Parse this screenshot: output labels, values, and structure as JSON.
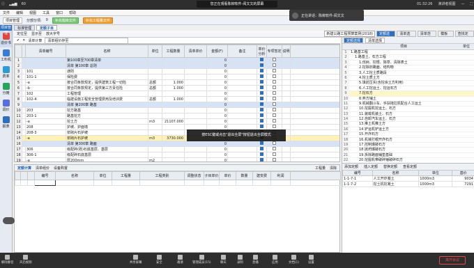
{
  "meeting_top": {
    "signal": "60",
    "share_text": "您正在观看陈柳软件-阅文文的屏幕",
    "clock": "01:32:26",
    "view_label": "演讲者视图",
    "colors": {
      "bg": "#2e2e2e"
    }
  },
  "toast": {
    "text": "正在讲话：陈柳软件-阅文文"
  },
  "app": {
    "menu": [
      "文件",
      "编辑",
      "视图",
      "工具",
      "窗口",
      "帮助"
    ],
    "toolbar": {
      "info": "项目管理",
      "count_label": "分部分项:",
      "count_value": "0",
      "green_btn": "补充题库文件",
      "orange_btn": "补充工程量文件"
    },
    "tabs": [
      "标准管理",
      "定额子目"
    ],
    "subtool": [
      "定位至",
      "显示至",
      "放大字号"
    ],
    "standard_label": "新建公路工程预算案例(2018)",
    "right_tabs": [
      "定额选择",
      "清单选择",
      "清单范本",
      "模板库",
      "查找定位"
    ],
    "filter_bar": {
      "a": "清单计算",
      "b": "清单库",
      "c": "清单组价存至"
    },
    "grid_headers": [
      "清单编号",
      "名称",
      "单位",
      "工程数量",
      "清单单价",
      "金额(F)",
      "备注",
      "单价分析",
      "专项暂定",
      "说明"
    ],
    "rows": [
      {
        "no": "1",
        "code": "",
        "name": "第100章至700章清单",
        "unit": "",
        "qty": "",
        "price": "",
        "amt": "0",
        "hl": true
      },
      {
        "no": "2",
        "code": "",
        "name": "清单 第100章 总则",
        "unit": "",
        "qty": "",
        "price": "",
        "amt": "0",
        "hl": true
      },
      {
        "no": "3",
        "code": "101",
        "name": "通则",
        "unit": "",
        "qty": "",
        "price": "",
        "amt": "0"
      },
      {
        "no": "4",
        "code": "101-1",
        "name": "保险费",
        "unit": "",
        "qty": "",
        "price": "",
        "amt": "0"
      },
      {
        "no": "5",
        "code": "-a",
        "name": "按合同条款规定，提供建筑工程一切险",
        "unit": "总额",
        "qty": "1.000",
        "price": "",
        "amt": "0"
      },
      {
        "no": "6",
        "code": "-b",
        "name": "按合同条款规定，提供第三方责任险",
        "unit": "总额",
        "qty": "1.000",
        "price": "",
        "amt": "0"
      },
      {
        "no": "7",
        "code": "102",
        "name": "工程管理",
        "unit": "",
        "qty": "",
        "price": "",
        "amt": "0"
      },
      {
        "no": "8",
        "code": "102-4",
        "name": "临建设施工程安全管理费用及培训费",
        "unit": "总额",
        "qty": "1.000",
        "price": "",
        "amt": "0"
      },
      {
        "no": "9",
        "code": "",
        "name": "清单 第200章 路基",
        "unit": "",
        "qty": "",
        "price": "",
        "amt": "0",
        "hl": true
      },
      {
        "no": "10",
        "code": "203",
        "name": "挖方路基",
        "unit": "",
        "qty": "",
        "price": "",
        "amt": "0"
      },
      {
        "no": "11",
        "code": "203-1",
        "name": "路基挖方",
        "unit": "",
        "qty": "",
        "price": "",
        "amt": "0"
      },
      {
        "no": "12",
        "code": "-a",
        "name": "挖土方",
        "unit": "m3",
        "qty": "21107.000",
        "price": "",
        "amt": "0"
      },
      {
        "no": "13",
        "code": "208",
        "name": "护坡、护面墙",
        "unit": "",
        "qty": "",
        "price": "",
        "amt": "0"
      },
      {
        "no": "14",
        "code": "208-3",
        "name": "浆砌片石护坡",
        "unit": "",
        "qty": "",
        "price": "",
        "amt": "0"
      },
      {
        "no": "15",
        "code": "-a",
        "name": "浆砌片石护坡",
        "unit": "m3",
        "qty": "3730.000",
        "price": "",
        "amt": "0",
        "sel": true
      },
      {
        "no": "16",
        "code": "",
        "name": "清单 第300章 路面",
        "unit": "",
        "qty": "",
        "price": "",
        "amt": "0",
        "hl": true
      },
      {
        "no": "17",
        "code": "306",
        "name": "级配碎(砾)石底基层、基层",
        "unit": "",
        "qty": "",
        "price": "",
        "amt": "0"
      },
      {
        "no": "18",
        "code": "306-1",
        "name": "级配碎石底基层",
        "unit": "",
        "qty": "",
        "price": "",
        "amt": "0"
      },
      {
        "no": "19",
        "code": "-a",
        "name": "厚200mm",
        "unit": "m2",
        "qty": "",
        "price": "",
        "amt": "0"
      },
      {
        "no": "20",
        "code": "",
        "name": "",
        "unit": "",
        "qty": "",
        "price": "",
        "amt": "0"
      }
    ],
    "overlay": "按ESC键或点击\"退出全屏\"按钮退出全屏模式",
    "bottom_tabs": [
      "定额计算",
      "清单组价",
      "设备购置"
    ],
    "bottom_tools": [
      "工程量",
      "清除"
    ],
    "bottom_headers": [
      "编号",
      "名称",
      "单位",
      "工程量",
      "工程类别",
      "调整状态",
      "子目单价",
      "单价",
      "数量",
      "建安费",
      "利润"
    ],
    "left_nav": [
      "项目管理",
      "造价书",
      "工料机",
      "费率",
      "分摊",
      "调价",
      "报表"
    ],
    "tree_header": [
      "项目",
      "单位"
    ],
    "tree_items": [
      "1.路基工程",
      "1.路基土、石方工程",
      "1.伐树、挖根、除草、清除表土",
      "2.挖除旧路面、结构物",
      "3.人工挖土质路段",
      "4.挖土质土方",
      "5.填前压实(含挖余土方利用)",
      "6.人工挖运土、挖运石方",
      "7.挖石方",
      "8.弃方铺土",
      "9.机械翻斗车、手扶拖拉机配合人工运土",
      "10.挖掘机挖运土、石方",
      "11.装载机装土、石方",
      "12.自卸汽车运土、石方",
      "13.推土机推土方",
      "14.铲运机铲运土方",
      "15.开炸石方",
      "16.机械打眼开炸石方",
      "17.控制爆破石方",
      "18.抛坍爆破石方",
      "19.拆除路面铺垫基础",
      "20.挖掘机带破碎锤破碎石方",
      "21.石方"
    ],
    "rbot_tools": [
      "添加定额",
      "插入定额",
      "替换定额",
      "查看定额"
    ],
    "rbot_headers": [
      "编号",
      "名称",
      "单位",
      "基价"
    ],
    "rbot_rows": [
      {
        "code": "1-1-7-1",
        "name": "人工开炸凝土",
        "unit": "1000m3",
        "price": "9034"
      },
      {
        "code": "1-1-7-2",
        "name": "挖土机挖凝土",
        "unit": "1000m3",
        "price": "7291"
      }
    ]
  },
  "statusbar": {
    "items": [
      "解除静音",
      "开启视频",
      "共享屏幕",
      "安全",
      "邀请",
      "管理成员(15)",
      "聊天",
      "录制",
      "直播",
      "应用",
      "文档(1)",
      "设置"
    ],
    "end": "离开会议"
  }
}
